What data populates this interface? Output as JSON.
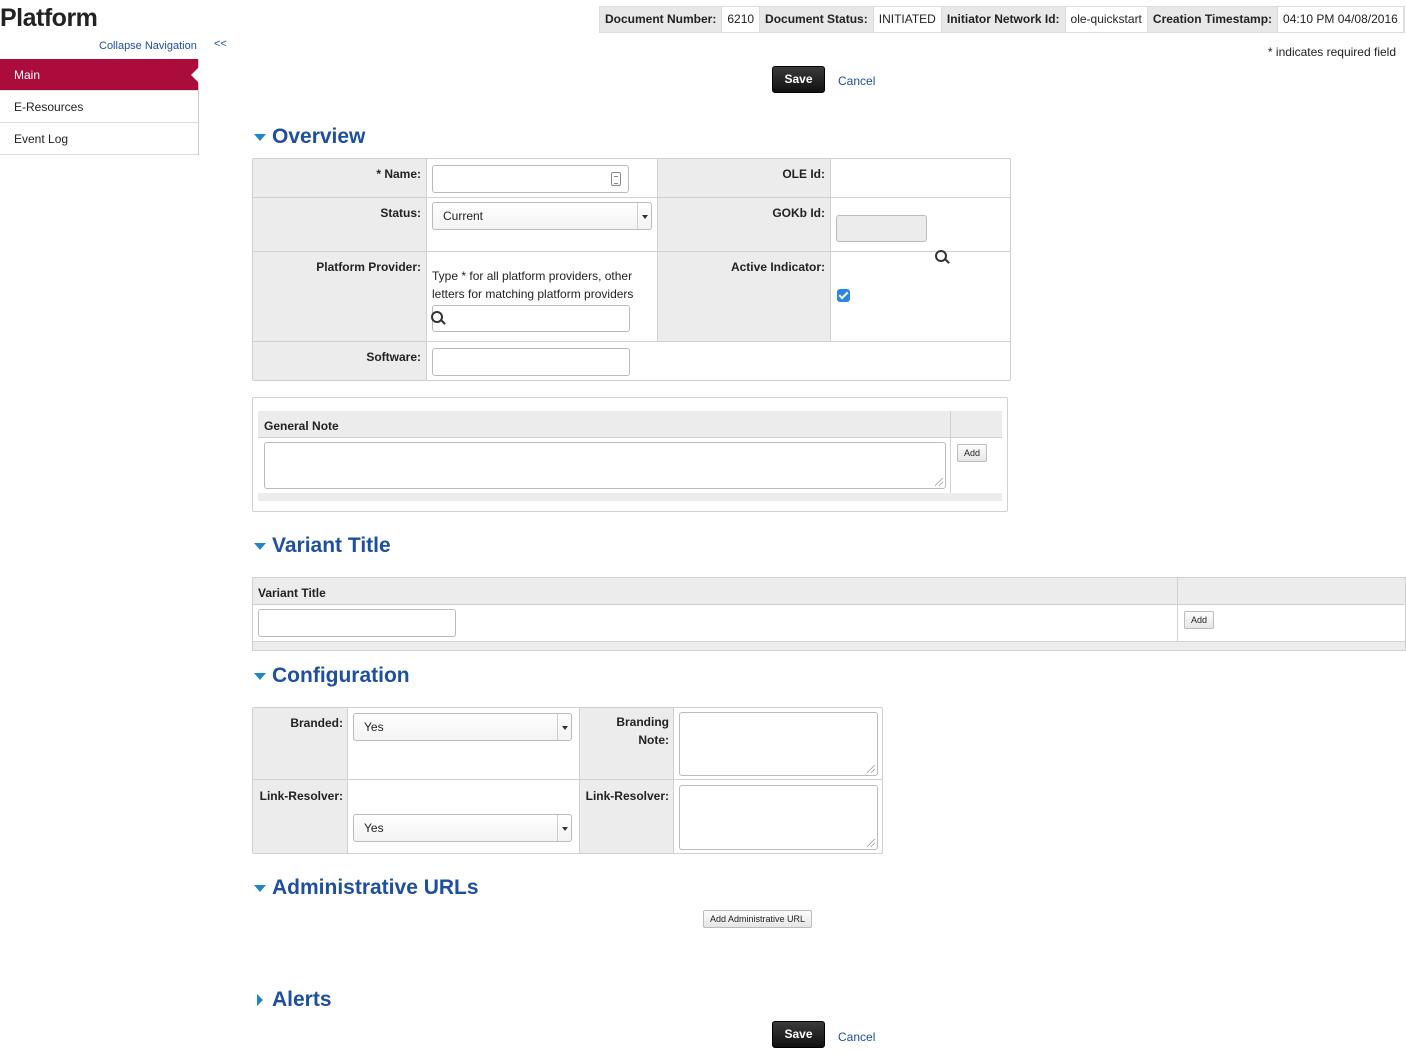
{
  "app": {
    "title": "Platform",
    "collapse_nav": "Collapse Navigation",
    "collapse_arrows": "<<"
  },
  "sidebar": {
    "items": [
      {
        "label": "Main",
        "active": true
      },
      {
        "label": "E-Resources",
        "active": false
      },
      {
        "label": "Event Log",
        "active": false
      }
    ]
  },
  "header": {
    "doc_number_label": "Document Number:",
    "doc_number": "6210",
    "doc_status_label": "Document Status:",
    "doc_status": "INITIATED",
    "initiator_label": "Initiator Network Id:",
    "initiator": "ole-quickstart",
    "timestamp_label": "Creation Timestamp:",
    "timestamp": "04:10 PM 04/08/2016",
    "required_note": "* indicates required field"
  },
  "actions": {
    "save": "Save",
    "cancel": "Cancel"
  },
  "overview": {
    "title": "Overview",
    "name_label": "* Name:",
    "name_value": "",
    "status_label": "Status:",
    "status_value": "Current",
    "provider_label": "Platform Provider:",
    "provider_hint": "Type * for all platform providers, other letters for matching platform providers",
    "software_label": "Software:",
    "ole_id_label": "OLE Id:",
    "gokb_id_label": "GOKb Id:",
    "active_label": "Active Indicator:",
    "active_checked": true
  },
  "general_note": {
    "header": "General Note",
    "add": "Add"
  },
  "variant_title": {
    "title": "Variant Title",
    "column_header": "Variant Title",
    "add": "Add"
  },
  "configuration": {
    "title": "Configuration",
    "branded_label": "Branded:",
    "branded_value": "Yes",
    "branding_note_label_1": "Branding",
    "branding_note_label_2": "Note:",
    "link_resolver_label": "Link-Resolver:",
    "link_resolver_value": "Yes",
    "link_resolver_note_label": "Link-Resolver:"
  },
  "admin_urls": {
    "title": "Administrative URLs",
    "add": "Add Administrative URL"
  },
  "alerts": {
    "title": "Alerts"
  }
}
